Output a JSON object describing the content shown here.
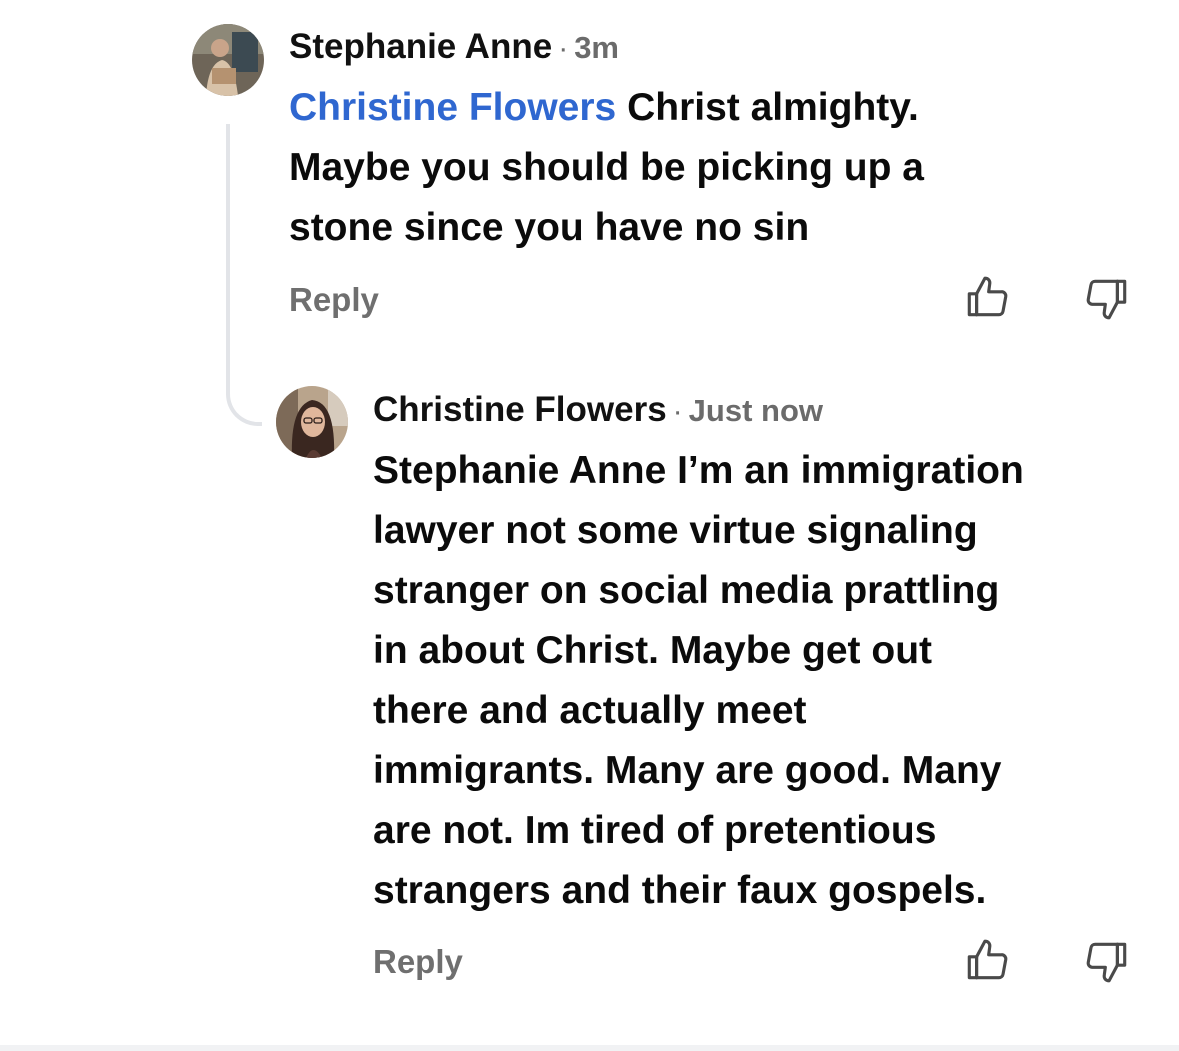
{
  "comments": [
    {
      "author": "Stephanie Anne",
      "separator": "·",
      "time": "3m",
      "mention": "Christine Flowers",
      "lines": [
        "Christ almighty.",
        "Maybe you should be picking up a",
        "stone since you have no sin"
      ],
      "reply_label": "Reply"
    },
    {
      "author": "Christine Flowers",
      "separator": "·",
      "time": "Just now",
      "lines": [
        "Stephanie Anne I’m an immigration",
        "lawyer not some virtue signaling",
        "stranger on social media prattling",
        "in about Christ. Maybe get out",
        "there and actually meet",
        "immigrants. Many are good. Many",
        "are not. Im tired of pretentious",
        "strangers and their faux gospels."
      ],
      "reply_label": "Reply"
    }
  ],
  "icons": {
    "like": "thumbs-up-icon",
    "dislike": "thumbs-down-icon"
  },
  "colors": {
    "mention": "#2f67d0",
    "meta_gray": "#6b6b6b",
    "thread_line": "#e2e4e8"
  }
}
